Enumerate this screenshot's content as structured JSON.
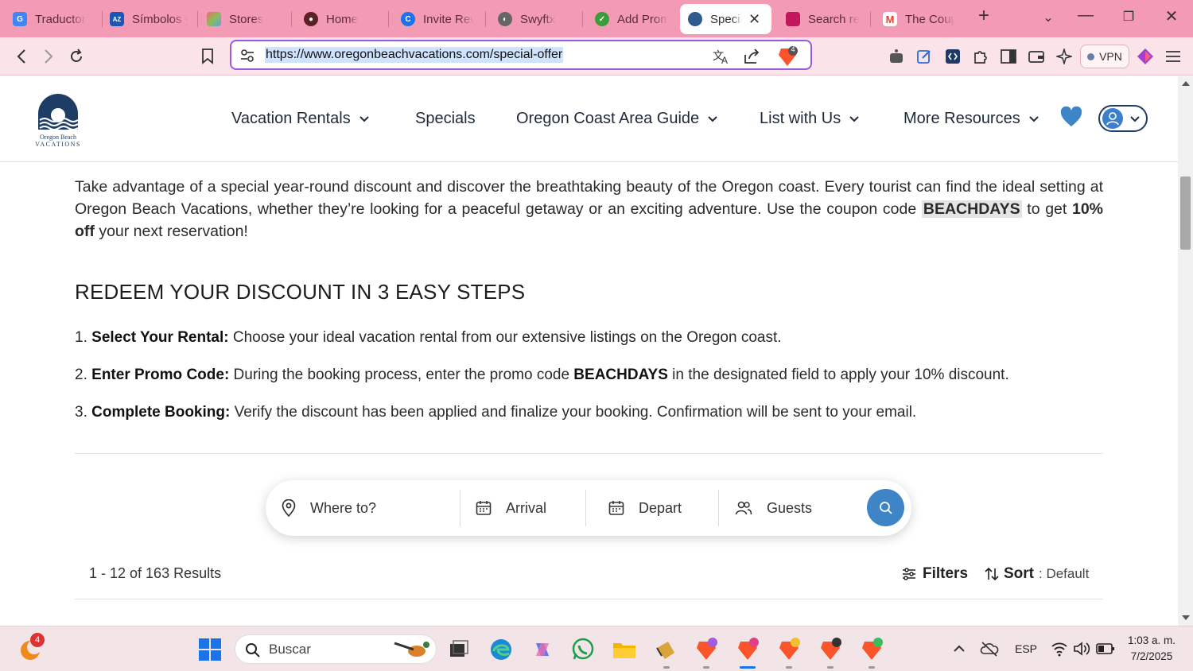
{
  "tabs": [
    {
      "title": "Traductor",
      "color": "#4285f4",
      "glyph": "G"
    },
    {
      "title": "Símbolos y",
      "color": "#1a56b7",
      "glyph": "AZ"
    },
    {
      "title": "Stores",
      "color": "#8bbd5a",
      "glyph": "▦"
    },
    {
      "title": "Home",
      "color": "#6b2a2a",
      "glyph": "●"
    },
    {
      "title": "Invite Rewards",
      "color": "#1a73e8",
      "glyph": "C"
    },
    {
      "title": "Swyftx",
      "color": "#555",
      "glyph": "◐"
    },
    {
      "title": "Add Promo",
      "color": "#3a9d3a",
      "glyph": "✓"
    },
    {
      "title": "Special Offer",
      "color": "#2e5a8e",
      "glyph": "▬",
      "active": true
    },
    {
      "title": "Search results",
      "color": "#c2185b",
      "glyph": "▭"
    },
    {
      "title": "The Coupon",
      "color": "#ea4335",
      "glyph": "M"
    }
  ],
  "toolbar": {
    "url": "https://www.oregonbeachvacations.com/special-offer",
    "vpn_label": "VPN",
    "shield_count": "4"
  },
  "site": {
    "logo_line1": "Oregon Beach",
    "logo_line2": "VACATIONS",
    "nav": [
      {
        "label": "Vacation Rentals",
        "dropdown": true
      },
      {
        "label": "Specials",
        "dropdown": false
      },
      {
        "label": "Oregon Coast Area Guide",
        "dropdown": true
      },
      {
        "label": "List with Us",
        "dropdown": true
      },
      {
        "label": "More Resources",
        "dropdown": true
      }
    ]
  },
  "content": {
    "intro_before": "Take advantage of a special year-round discount and discover the breathtaking beauty of the Oregon coast. Every tourist can find the ideal setting at Oregon Beach Vacations, whether they’re looking for a peaceful getaway or an exciting adventure. Use the coupon code ",
    "intro_code": "BEACHDAYS",
    "intro_mid": " to get ",
    "intro_bold": "10% off",
    "intro_after": " your next reservation!",
    "steps_heading": "REDEEM YOUR DISCOUNT IN 3 EASY STEPS",
    "steps": [
      {
        "num": "1.",
        "title": "Select Your Rental:",
        "text": " Choose your ideal vacation rental from our extensive listings on the Oregon coast."
      },
      {
        "num": "2.",
        "title": "Enter Promo Code:",
        "text_before": " During the booking process, enter the promo code ",
        "code": "BEACHDAYS",
        "text_after": " in the designated field to apply your 10% discount."
      },
      {
        "num": "3.",
        "title": "Complete Booking:",
        "text": " Verify the discount has been applied and finalize your booking. Confirmation will be sent to your email."
      }
    ],
    "search": {
      "where_placeholder": "Where to?",
      "arrival": "Arrival",
      "depart": "Depart",
      "guests": "Guests"
    },
    "results_text": "1 - 12 of 163 Results",
    "filters_label": "Filters",
    "sort_label": "Sort",
    "sort_value": ": Default"
  },
  "taskbar": {
    "notif_count": "4",
    "search_placeholder": "Buscar",
    "lang": "ESP",
    "time": "1:03 a. m.",
    "date": "7/2/2025"
  }
}
